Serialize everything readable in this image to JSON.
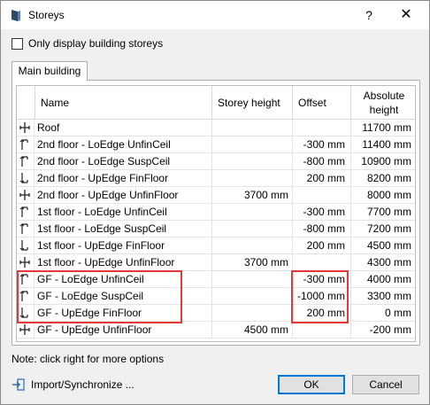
{
  "window": {
    "title": "Storeys",
    "help_label": "?",
    "close_label": "✕"
  },
  "filter": {
    "only_building_storeys_label": "Only display building storeys",
    "checked": false
  },
  "tabs": [
    {
      "label": "Main building"
    }
  ],
  "table": {
    "columns": {
      "name": "Name",
      "storey_height": "Storey height",
      "offset": "Offset",
      "absolute_height": "Absolute height"
    },
    "rows": [
      {
        "icon": "storey-main-icon",
        "name": "Roof",
        "storey_height": "",
        "offset": "",
        "absolute_height": "11700 mm"
      },
      {
        "icon": "storey-loedge-icon",
        "name": "2nd floor - LoEdge UnfinCeil",
        "storey_height": "",
        "offset": "-300 mm",
        "absolute_height": "11400 mm"
      },
      {
        "icon": "storey-loedge-icon",
        "name": "2nd floor - LoEdge SuspCeil",
        "storey_height": "",
        "offset": "-800 mm",
        "absolute_height": "10900 mm"
      },
      {
        "icon": "storey-upedge-icon",
        "name": "2nd floor - UpEdge FinFloor",
        "storey_height": "",
        "offset": "200 mm",
        "absolute_height": "8200 mm"
      },
      {
        "icon": "storey-main-icon",
        "name": "2nd floor - UpEdge UnfinFloor",
        "storey_height": "3700 mm",
        "offset": "",
        "absolute_height": "8000 mm"
      },
      {
        "icon": "storey-loedge-icon",
        "name": "1st floor - LoEdge UnfinCeil",
        "storey_height": "",
        "offset": "-300 mm",
        "absolute_height": "7700 mm"
      },
      {
        "icon": "storey-loedge-icon",
        "name": "1st floor - LoEdge SuspCeil",
        "storey_height": "",
        "offset": "-800 mm",
        "absolute_height": "7200 mm"
      },
      {
        "icon": "storey-upedge-icon",
        "name": "1st floor - UpEdge FinFloor",
        "storey_height": "",
        "offset": "200 mm",
        "absolute_height": "4500 mm"
      },
      {
        "icon": "storey-main-icon",
        "name": "1st floor - UpEdge UnfinFloor",
        "storey_height": "3700 mm",
        "offset": "",
        "absolute_height": "4300 mm"
      },
      {
        "icon": "storey-loedge-icon",
        "name": "GF - LoEdge UnfinCeil",
        "storey_height": "",
        "offset": "-300 mm",
        "absolute_height": "4000 mm"
      },
      {
        "icon": "storey-loedge-icon",
        "name": "GF - LoEdge SuspCeil",
        "storey_height": "",
        "offset": "-1000 mm",
        "absolute_height": "3300 mm"
      },
      {
        "icon": "storey-upedge-icon",
        "name": "GF - UpEdge FinFloor",
        "storey_height": "",
        "offset": "200 mm",
        "absolute_height": "0 mm"
      },
      {
        "icon": "storey-main-icon",
        "name": "GF - UpEdge UnfinFloor",
        "storey_height": "4500 mm",
        "offset": "",
        "absolute_height": "-200 mm"
      }
    ]
  },
  "annotations": {
    "highlight_color": "#e53935"
  },
  "footer": {
    "note": "Note: click right for more options",
    "import_label": "Import/Synchronize ...",
    "ok_label": "OK",
    "cancel_label": "Cancel"
  },
  "colors": {
    "accent": "#0078d7",
    "highlight": "#e53935"
  }
}
